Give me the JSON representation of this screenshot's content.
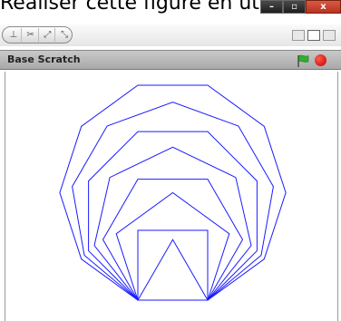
{
  "caption": "Réaliser cette figure en utili",
  "window_controls": {
    "minimize": "–",
    "maximize": "▫",
    "close": "x"
  },
  "toolbar": {
    "tools": [
      "stamp-icon",
      "scissors-icon",
      "grow-icon",
      "shrink-icon"
    ],
    "tool_glyphs": [
      "⊥",
      "✂",
      "⤢",
      "⤡"
    ],
    "view_modes": [
      "small-stage-icon",
      "normal-stage-icon",
      "presentation-icon"
    ]
  },
  "stage": {
    "title": "Base Scratch"
  },
  "colors": {
    "line": "#1a1aff",
    "flag": "#2fae2f",
    "stop": "#d40000"
  },
  "drawing": {
    "description_free": true,
    "polygons_sides": [
      3,
      4,
      5,
      6,
      7,
      8,
      9,
      10
    ],
    "shared_base_edge": true
  }
}
